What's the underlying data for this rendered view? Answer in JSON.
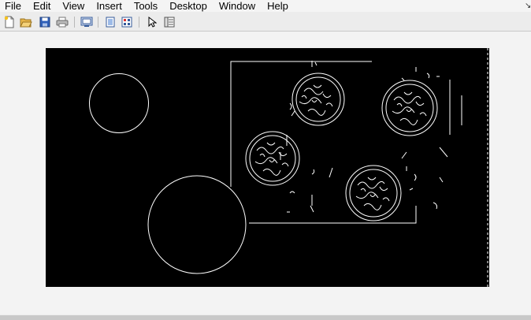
{
  "menubar": {
    "items": [
      "File",
      "Edit",
      "View",
      "Insert",
      "Tools",
      "Desktop",
      "Window",
      "Help"
    ]
  },
  "toolbar": {
    "buttons": [
      {
        "name": "new-figure-icon"
      },
      {
        "name": "open-file-icon"
      },
      {
        "name": "save-icon"
      },
      {
        "name": "print-icon"
      },
      {
        "name": "link-plot-icon"
      },
      {
        "name": "hide-plot-tools-icon"
      },
      {
        "name": "show-plot-tools-icon"
      },
      {
        "name": "edit-plot-icon"
      },
      {
        "name": "plot-browser-icon"
      }
    ]
  },
  "image": {
    "description_type": "edge-detection binary image",
    "background": "#000000",
    "edge_color": "#ffffff"
  }
}
